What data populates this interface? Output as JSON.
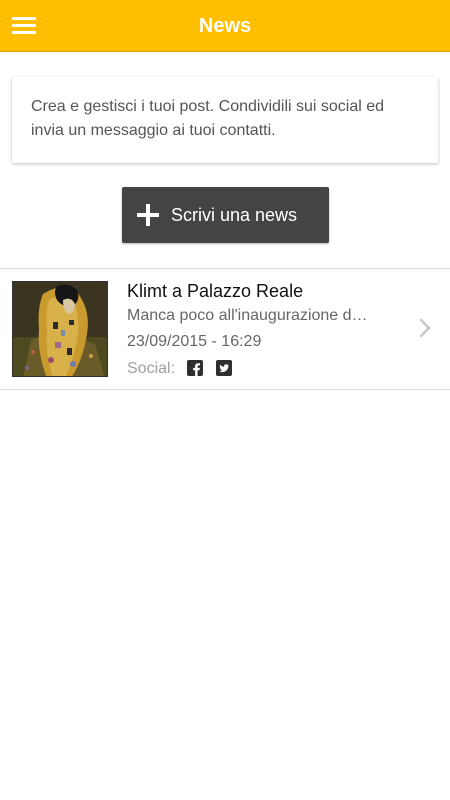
{
  "header": {
    "title": "News",
    "background_color": "#FFBF00",
    "menu_icon": "hamburger-menu-icon"
  },
  "intro": {
    "text": "Crea e gestisci i tuoi post. Condividili sui social ed invia un messaggio ai tuoi contatti."
  },
  "write_button": {
    "label": "Scrivi una news",
    "icon": "plus-icon",
    "background_color": "#444444"
  },
  "news": [
    {
      "title": "Klimt a Palazzo Reale",
      "excerpt": "Manca poco all'inaugurazione d…",
      "date": "23/09/2015 - 16:29",
      "social_label": "Social:",
      "social_icons": [
        "facebook-icon",
        "twitter-icon"
      ],
      "thumbnail": "klimt-thumbnail"
    }
  ]
}
